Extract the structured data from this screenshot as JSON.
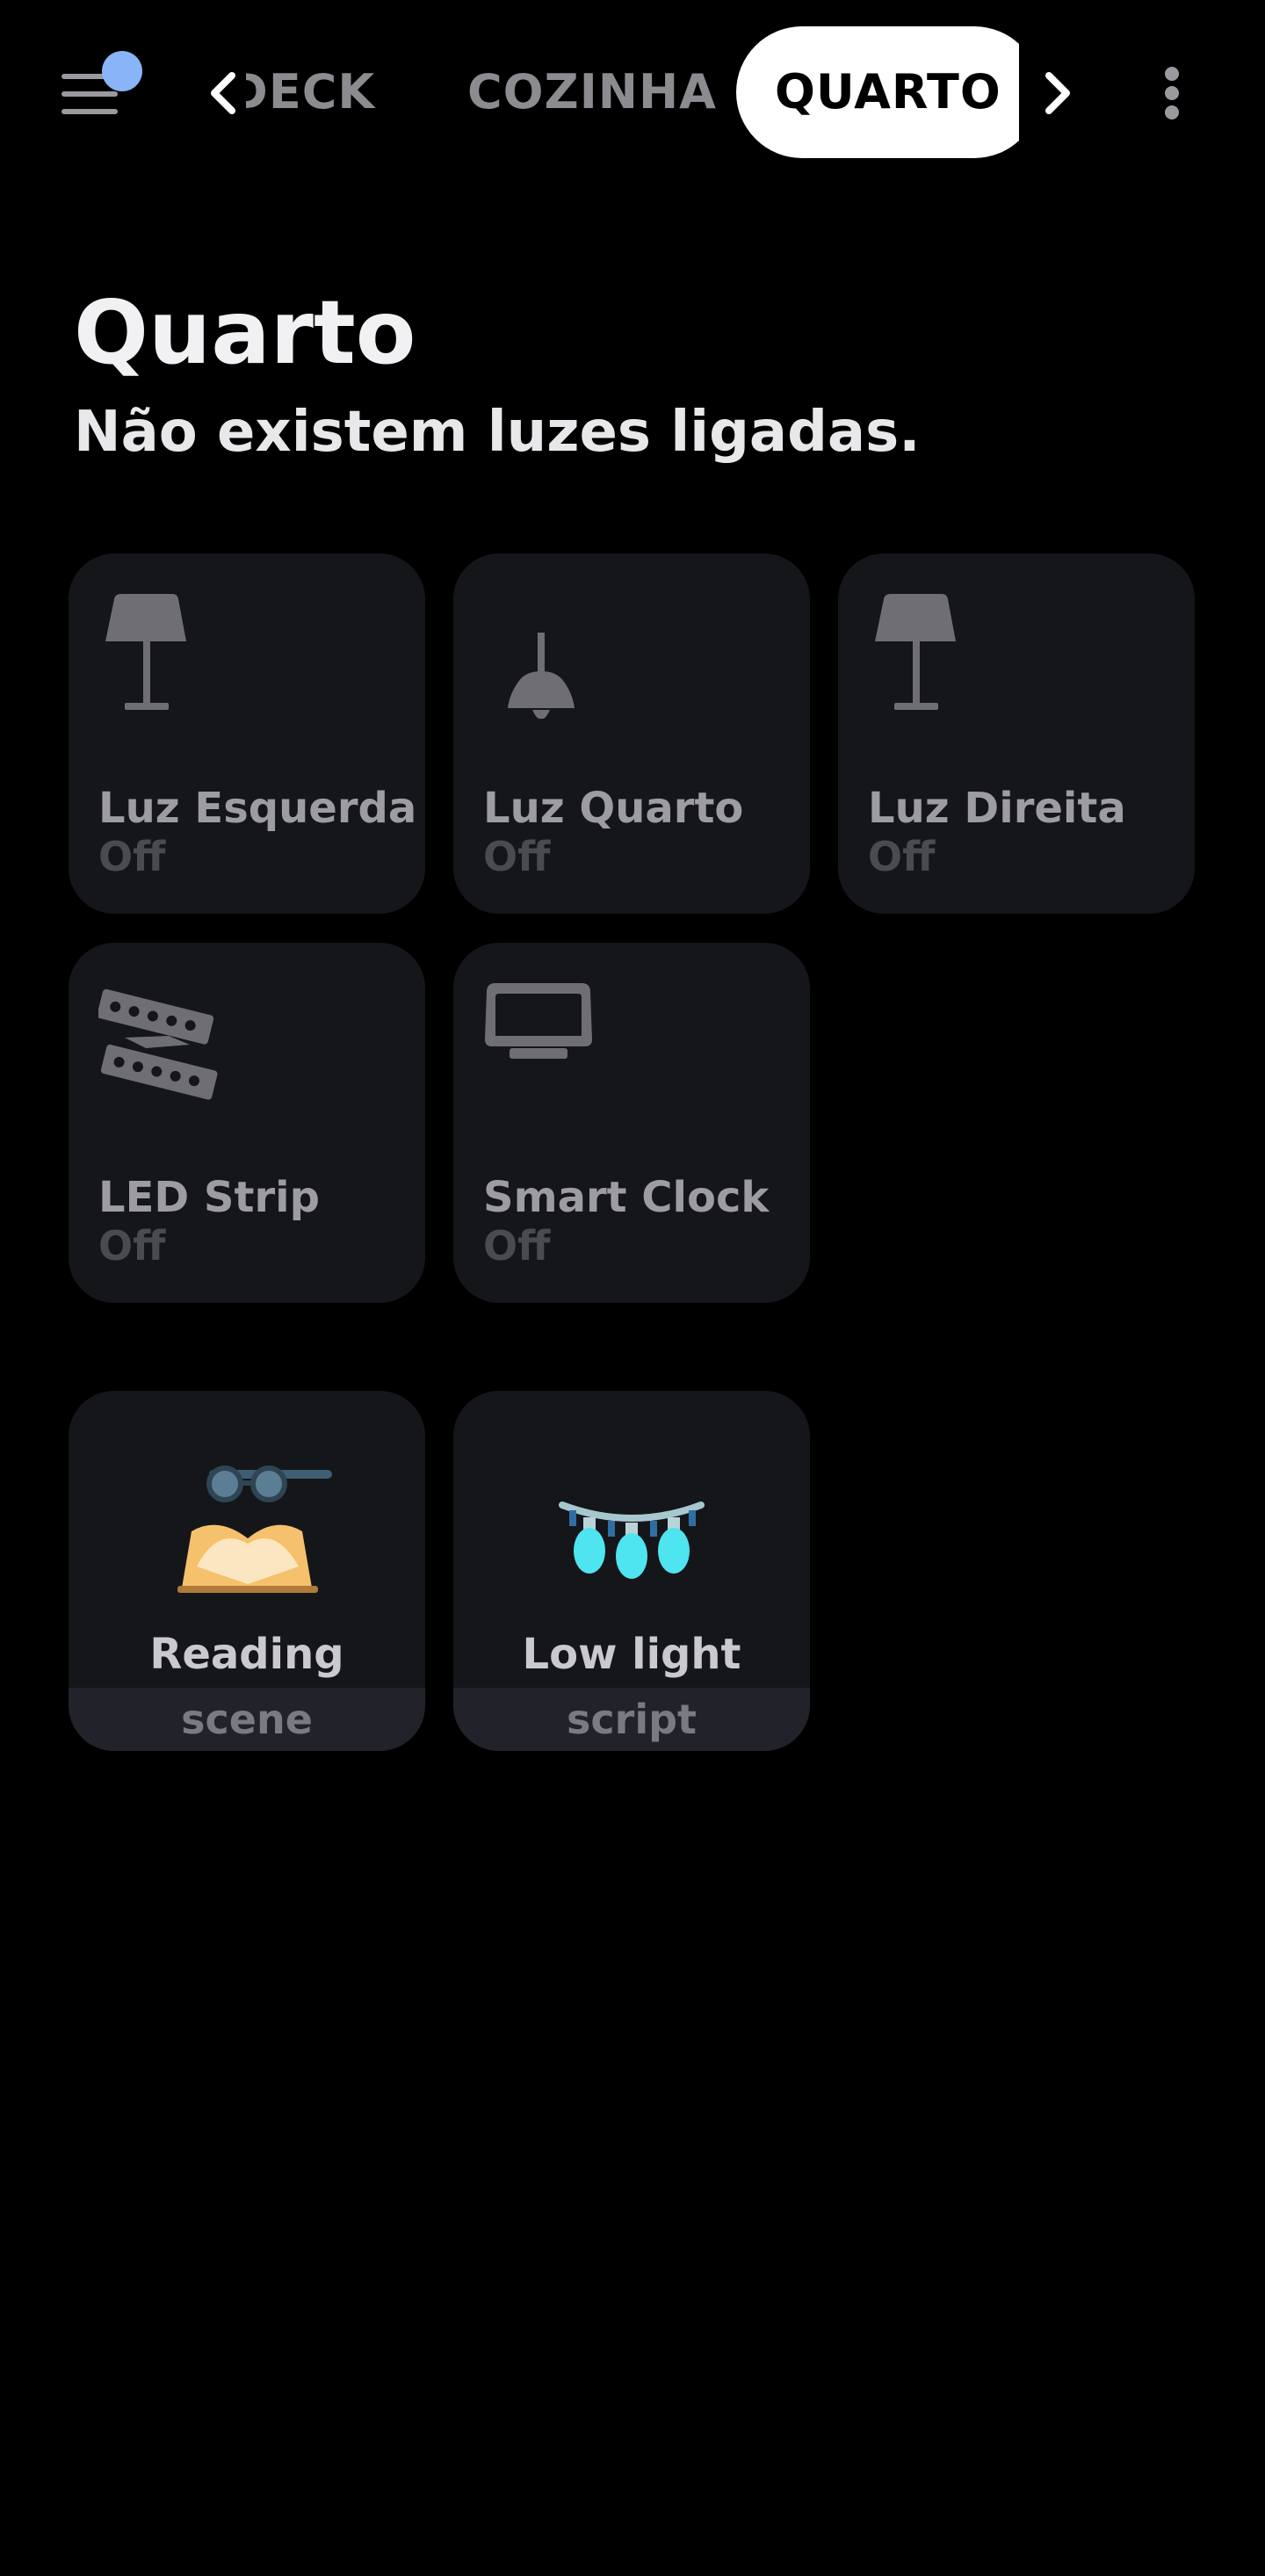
{
  "tabs": {
    "items": [
      "DECK",
      "COZINHA",
      "QUARTO"
    ],
    "active": "QUARTO"
  },
  "header": {
    "title": "Quarto",
    "subtitle": "Não existem luzes ligadas."
  },
  "devices": [
    {
      "name": "Luz Esquerda",
      "state": "Off",
      "icon": "table-lamp-icon"
    },
    {
      "name": "Luz Quarto",
      "state": "Off",
      "icon": "ceiling-lamp-icon"
    },
    {
      "name": "Luz Direita",
      "state": "Off",
      "icon": "table-lamp-icon"
    },
    {
      "name": "LED Strip",
      "state": "Off",
      "icon": "led-strip-icon"
    },
    {
      "name": "Smart Clock",
      "state": "Off",
      "icon": "smart-display-icon"
    }
  ],
  "scenes": [
    {
      "name": "Reading",
      "type": "scene",
      "icon": "open-book-glasses-icon"
    },
    {
      "name": "Low light",
      "type": "script",
      "icon": "string-lights-icon"
    }
  ],
  "colors": {
    "background": "#000000",
    "card": "#15161a",
    "active_tab": "#ffffff",
    "notification_dot": "#8ab4f8",
    "light_bulbs": "#4ee4f0"
  }
}
